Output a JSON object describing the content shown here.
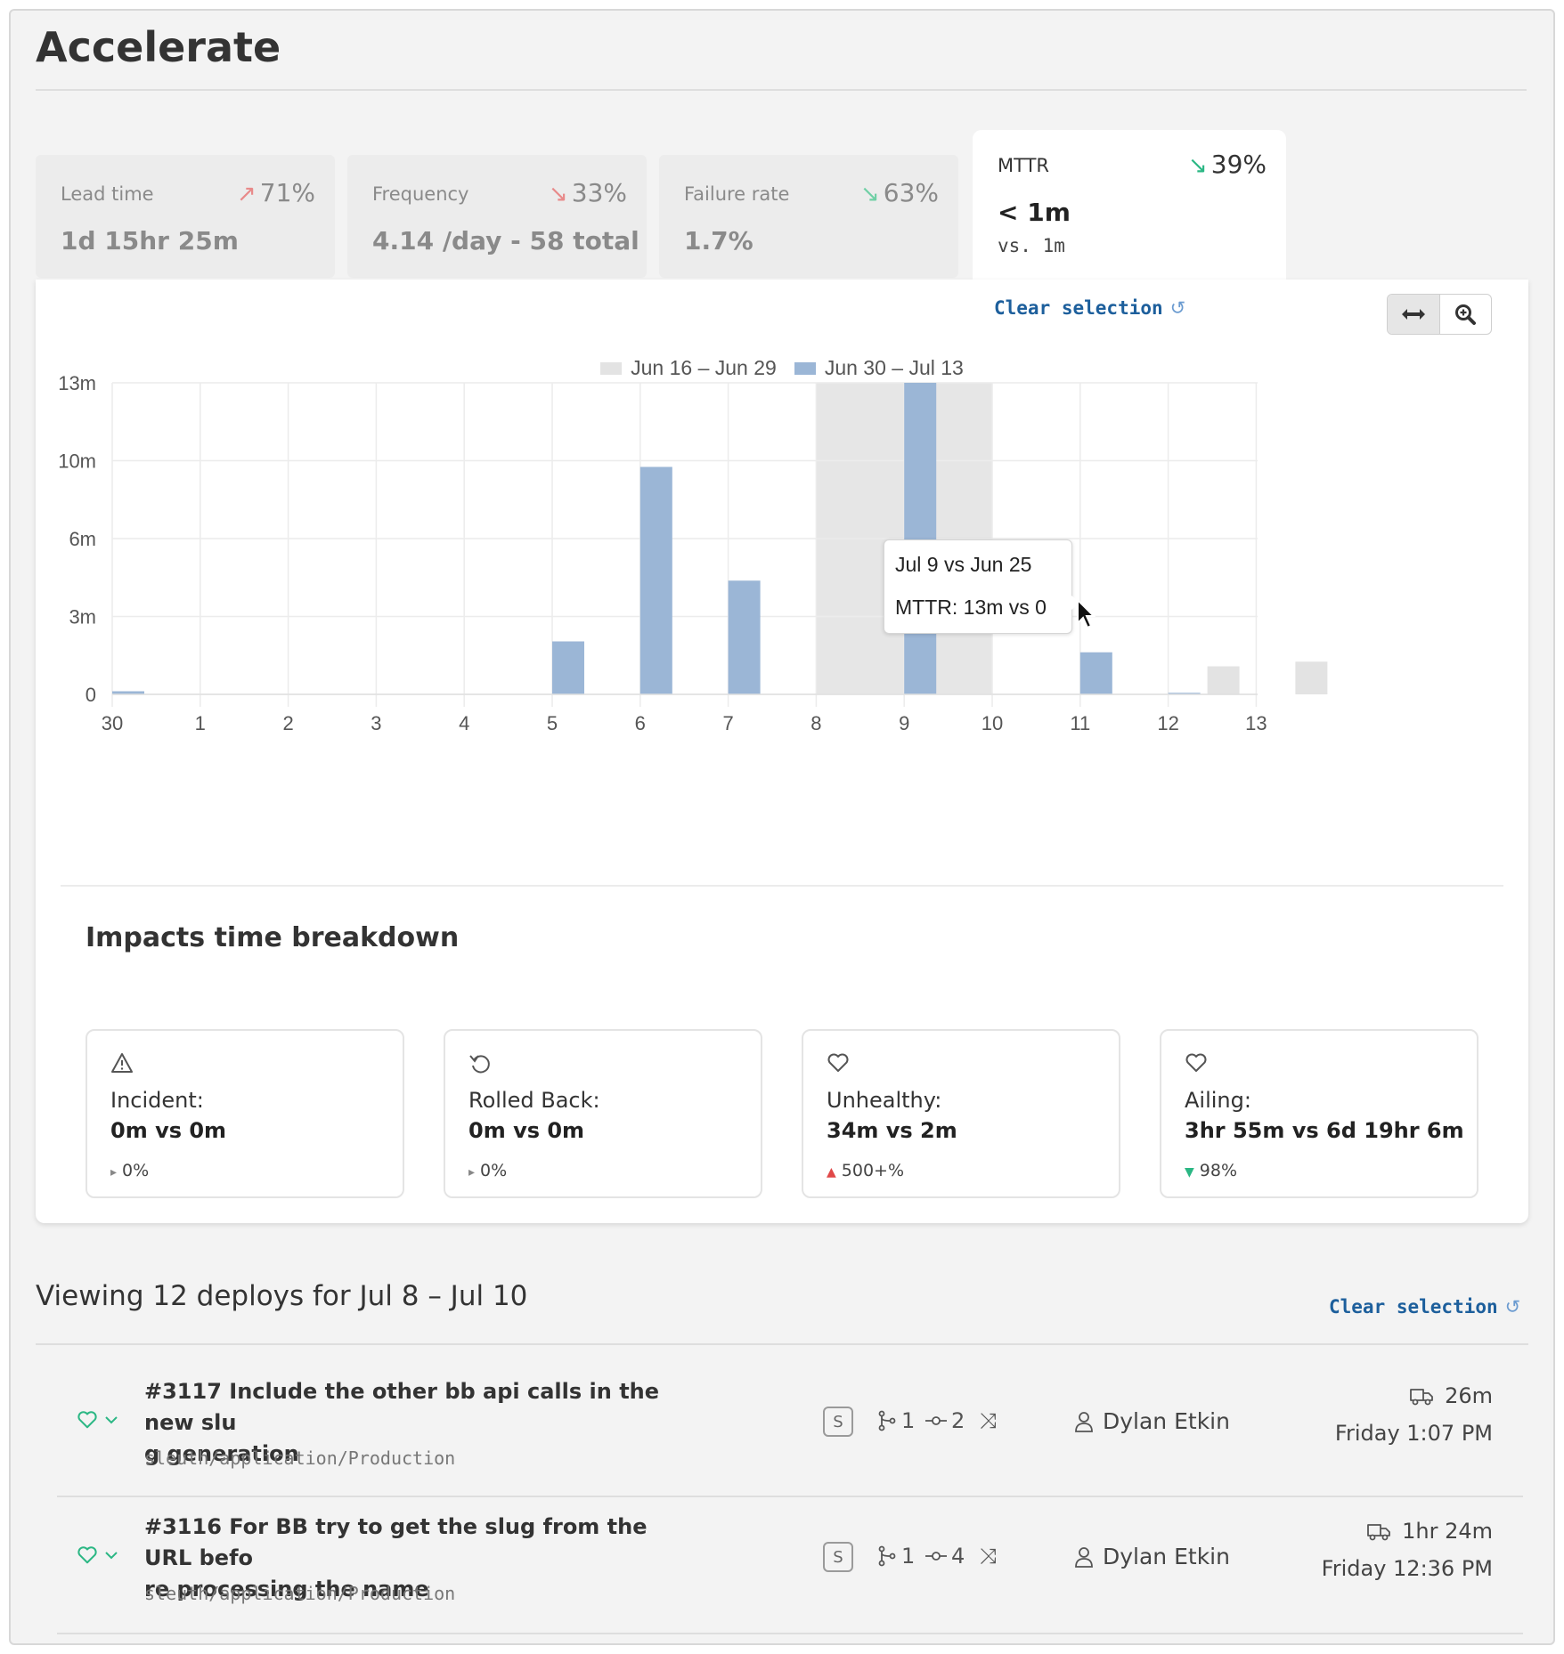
{
  "page": {
    "title": "Accelerate"
  },
  "metrics": [
    {
      "label": "Lead time",
      "change": "71%",
      "trend": "up-bad",
      "value": "1d 15hr 25m"
    },
    {
      "label": "Frequency",
      "change": "33%",
      "trend": "down-bad",
      "value": "4.14 /day - 58 total"
    },
    {
      "label": "Failure rate",
      "change": "63%",
      "trend": "down-good",
      "value": "1.7%"
    },
    {
      "label": "MTTR",
      "change": "39%",
      "trend": "down-good",
      "value": "< 1m",
      "vs": "vs. 1m"
    }
  ],
  "chart_toolbar": {
    "clear_selection": "Clear selection"
  },
  "chart_data": {
    "type": "bar",
    "categories": [
      "30",
      "1",
      "2",
      "3",
      "4",
      "5",
      "6",
      "7",
      "8",
      "9",
      "10",
      "11",
      "12",
      "13"
    ],
    "series": [
      {
        "name": "Jun 16 – Jun 29",
        "color": "#e3e3e3",
        "values": [
          0,
          0,
          0,
          0,
          0,
          0,
          0,
          0,
          0,
          0,
          0,
          0,
          1.8,
          2.1
        ]
      },
      {
        "name": "Jun 30 – Jul 13",
        "color": "#9bb6d6",
        "values": [
          0.2,
          0,
          0,
          0,
          0,
          3.4,
          14.6,
          7.3,
          0,
          20,
          0,
          2.7,
          0.1,
          0
        ]
      }
    ],
    "y_ticks": [
      "0",
      "3m",
      "6m",
      "10m",
      "13m"
    ],
    "ylim": [
      0,
      20
    ],
    "selection": {
      "from": "8",
      "to": "10"
    },
    "grid": true,
    "legend": "top-center",
    "tooltip": {
      "line1": "Jul 9 vs Jun 25",
      "line2": "MTTR: 13m vs 0"
    }
  },
  "breakdown": {
    "title": "Impacts time breakdown",
    "cards": [
      {
        "icon": "warning-icon",
        "label": "Incident:",
        "value": "0m vs 0m",
        "change": "0%",
        "trend": "flat"
      },
      {
        "icon": "rollback-icon",
        "label": "Rolled Back:",
        "value": "0m vs 0m",
        "change": "0%",
        "trend": "flat"
      },
      {
        "icon": "heart-icon",
        "label": "Unhealthy:",
        "value": "34m vs 2m",
        "change": "500+%",
        "trend": "up"
      },
      {
        "icon": "heart-icon",
        "label": "Ailing:",
        "value": "3hr 55m vs 6d 19hr 6m",
        "change": "98%",
        "trend": "down"
      }
    ]
  },
  "deploys": {
    "heading": "Viewing 12 deploys for Jul 8 – Jul 10",
    "clear_selection": "Clear selection",
    "items": [
      {
        "title_line1": "#3117 Include the other bb api calls in the new slu",
        "title_line2": "g generation",
        "path": "sleuth/application/Production",
        "badge": "S",
        "branches": "1",
        "commits": "2",
        "author": "Dylan Etkin",
        "duration": "26m",
        "when": "Friday 1:07 PM"
      },
      {
        "title_line1": "#3116 For BB try to get the slug from the URL befo",
        "title_line2": "re processing the name",
        "path": "sleuth/application/Production",
        "badge": "S",
        "branches": "1",
        "commits": "4",
        "author": "Dylan Etkin",
        "duration": "1hr 24m",
        "when": "Friday 12:36 PM"
      }
    ]
  }
}
